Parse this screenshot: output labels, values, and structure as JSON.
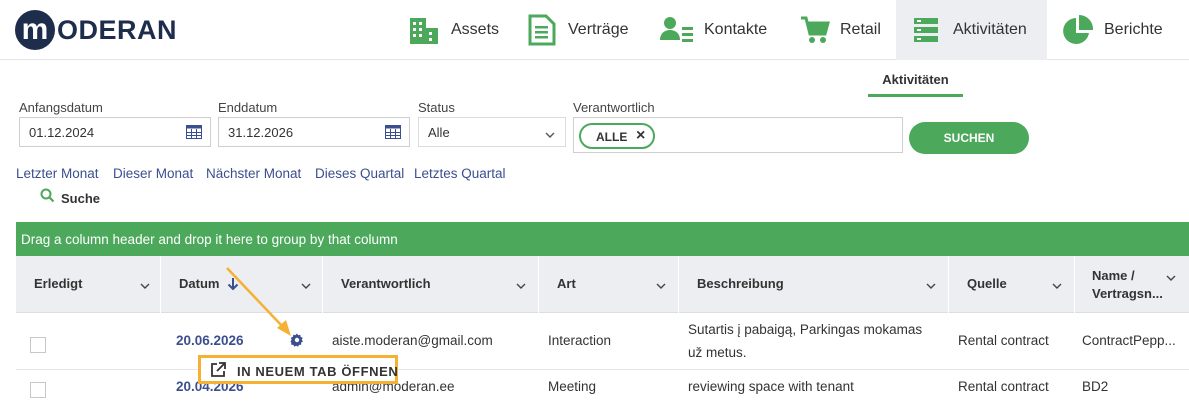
{
  "brand": {
    "logo_letter": "m",
    "logo_text": "ODERAN"
  },
  "nav": [
    {
      "label": "Assets",
      "icon": "building-icon"
    },
    {
      "label": "Verträge",
      "icon": "document-icon"
    },
    {
      "label": "Kontakte",
      "icon": "contacts-icon"
    },
    {
      "label": "Retail",
      "icon": "cart-icon"
    },
    {
      "label": "Aktivitäten",
      "icon": "activities-icon",
      "active": true
    },
    {
      "label": "Berichte",
      "icon": "pie-chart-icon"
    }
  ],
  "subtab": {
    "label": "Aktivitäten"
  },
  "filters": {
    "start_label": "Anfangsdatum",
    "start_value": "01.12.2024",
    "end_label": "Enddatum",
    "end_value": "31.12.2026",
    "status_label": "Status",
    "status_value": "Alle",
    "responsible_label": "Verantwortlich",
    "responsible_chip": "ALLE",
    "search_button": "SUCHEN"
  },
  "quick_links": [
    "Letzter Monat",
    "Dieser Monat",
    "Nächster Monat",
    "Dieses Quartal",
    "Letztes Quartal"
  ],
  "search_toggle": "Suche",
  "grid": {
    "group_hint": "Drag a column header and drop it here to group by that column",
    "columns": [
      "Erledigt",
      "Datum",
      "Verantwortlich",
      "Art",
      "Beschreibung",
      "Quelle",
      "Name /",
      "Vertragsn..."
    ],
    "rows": [
      {
        "date": "20.06.2026",
        "responsible": "aiste.moderan@gmail.com",
        "type": "Interaction",
        "description_line1": "Sutartis į pabaigą, Parkingas mokamas",
        "description_line2": "už metus.",
        "source": "Rental contract",
        "name": "ContractPepp..."
      },
      {
        "date": "20.04.2026",
        "responsible": "admin@moderan.ee",
        "type": "Meeting",
        "description_line1": "reviewing space with tenant",
        "source": "Rental contract",
        "name": "BD2"
      }
    ]
  },
  "popup": {
    "label": "IN NEUEM TAB ÖFFNEN",
    "icon": "external-link-icon"
  },
  "colors": {
    "accent": "#4ca95c",
    "navy": "#1f2d4d",
    "link": "#3b4f8f",
    "highlight": "#f5b133"
  }
}
